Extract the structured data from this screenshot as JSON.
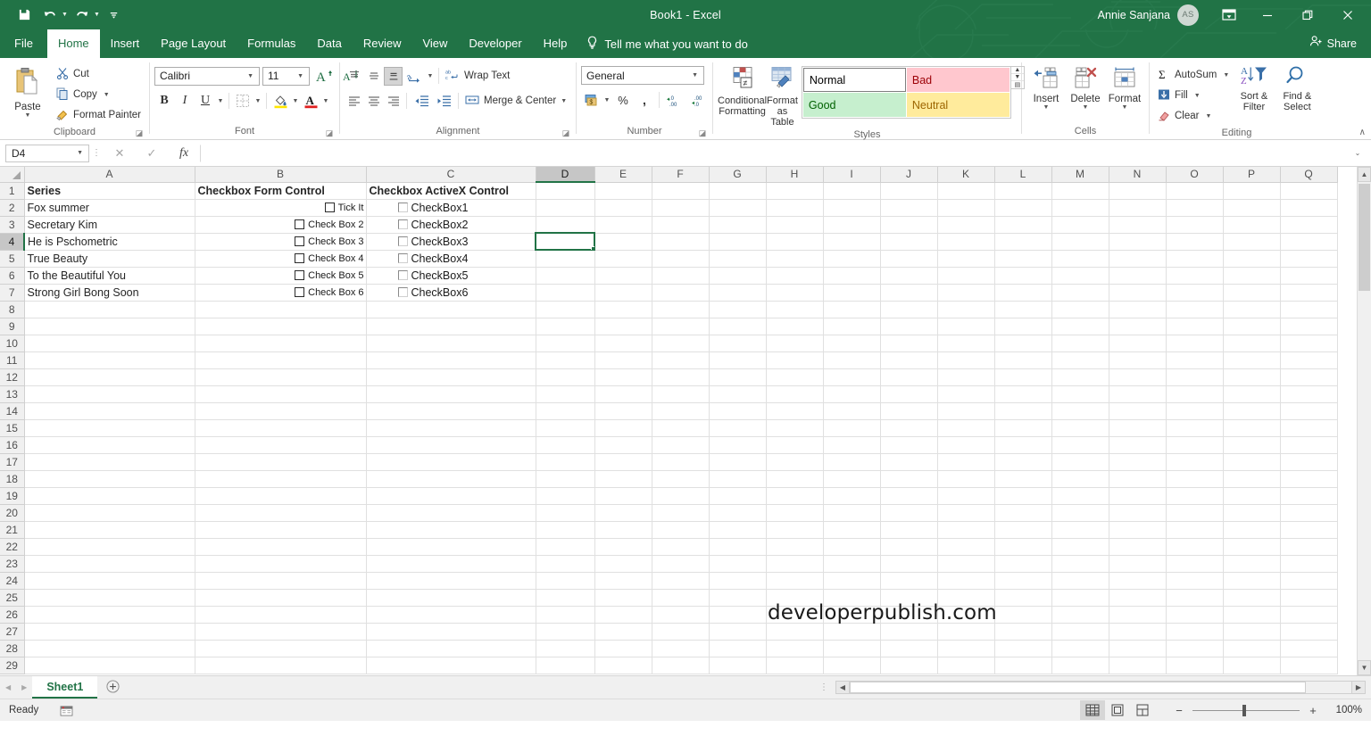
{
  "titlebar": {
    "document_title": "Book1  -  Excel",
    "account_name": "Annie Sanjana",
    "account_initials": "AS",
    "qat": [
      {
        "name": "save-icon",
        "label": "Save"
      },
      {
        "name": "undo-icon",
        "label": "Undo"
      },
      {
        "name": "redo-icon",
        "label": "Redo"
      },
      {
        "name": "customize-quick-access-toolbar-icon",
        "label": "Customize Quick Access Toolbar"
      }
    ],
    "ribbon_display_options": "Ribbon Display Options",
    "minimize": "—",
    "restore": "❐",
    "close": "✕"
  },
  "tabs": {
    "items": [
      {
        "label": "File",
        "active": false
      },
      {
        "label": "Home",
        "active": true
      },
      {
        "label": "Insert",
        "active": false
      },
      {
        "label": "Page Layout",
        "active": false
      },
      {
        "label": "Formulas",
        "active": false
      },
      {
        "label": "Data",
        "active": false
      },
      {
        "label": "Review",
        "active": false
      },
      {
        "label": "View",
        "active": false
      },
      {
        "label": "Developer",
        "active": false
      },
      {
        "label": "Help",
        "active": false
      }
    ],
    "tell_me": "Tell me what you want to do",
    "share": "Share"
  },
  "ribbon": {
    "clipboard": {
      "group_label": "Clipboard",
      "paste": "Paste",
      "cut": "Cut",
      "copy": "Copy",
      "format_painter": "Format Painter"
    },
    "font": {
      "group_label": "Font",
      "font_family": "Calibri",
      "font_size": "11",
      "grow_font": "A",
      "shrink_font": "A",
      "bold": "B",
      "italic": "I",
      "underline": "U",
      "borders": "Borders",
      "fill_color": "Fill Color",
      "font_color": "A"
    },
    "alignment": {
      "group_label": "Alignment",
      "top_align": "Top Align",
      "middle_align": "Middle Align",
      "bottom_align": "Bottom Align",
      "orientation": "Orientation",
      "align_left": "Align Left",
      "center": "Center",
      "align_right": "Align Right",
      "decrease_indent": "Decrease Indent",
      "increase_indent": "Increase Indent",
      "wrap_text": "Wrap Text",
      "merge_center": "Merge & Center"
    },
    "number": {
      "group_label": "Number",
      "format": "General",
      "accounting": "Accounting Number Format",
      "percent": "%",
      "comma": ",",
      "increase_decimal": "Increase Decimal",
      "decrease_decimal": "Decrease Decimal"
    },
    "styles": {
      "group_label": "Styles",
      "conditional_formatting": "Conditional Formatting",
      "format_as_table": "Format as Table",
      "cells": [
        {
          "label": "Normal",
          "kind": "normal"
        },
        {
          "label": "Bad",
          "kind": "bad"
        },
        {
          "label": "Good",
          "kind": "good"
        },
        {
          "label": "Neutral",
          "kind": "neutral"
        }
      ]
    },
    "cells_group": {
      "group_label": "Cells",
      "insert": "Insert",
      "delete": "Delete",
      "format": "Format"
    },
    "editing": {
      "group_label": "Editing",
      "autosum": "AutoSum",
      "fill": "Fill",
      "clear": "Clear",
      "sort_filter": "Sort &\nFilter",
      "sort_filter_l1": "Sort &",
      "sort_filter_l2": "Filter",
      "find_select_l1": "Find &",
      "find_select_l2": "Select"
    },
    "collapse_ribbon": "∧"
  },
  "formula_bar": {
    "name_box": "D4",
    "cancel": "✕",
    "enter": "✓",
    "insert_function": "fx",
    "formula_value": "",
    "expand": "⌄"
  },
  "grid": {
    "columns": [
      "A",
      "B",
      "C",
      "D",
      "E",
      "F",
      "G",
      "H",
      "I",
      "J",
      "K",
      "L",
      "M",
      "N",
      "O",
      "P",
      "Q"
    ],
    "selected_column": "D",
    "selected_row": 4,
    "selected_cell": "D4",
    "rows": [
      1,
      2,
      3,
      4,
      5,
      6,
      7,
      8,
      9,
      10,
      11,
      12,
      13,
      14,
      15,
      16,
      17,
      18,
      19,
      20,
      21,
      22,
      23,
      24,
      25,
      26,
      27,
      28,
      29
    ],
    "data": [
      {
        "row": 1,
        "A": "Series",
        "B_header": "Checkbox Form Control",
        "C_header": "Checkbox ActiveX Control"
      },
      {
        "row": 2,
        "A": "Fox summer",
        "B_checkbox": "Tick It",
        "C_checkbox": "CheckBox1"
      },
      {
        "row": 3,
        "A": "Secretary Kim",
        "B_checkbox": "Check Box 2",
        "C_checkbox": "CheckBox2"
      },
      {
        "row": 4,
        "A": "He is Pschometric",
        "B_checkbox": "Check Box 3",
        "C_checkbox": "CheckBox3"
      },
      {
        "row": 5,
        "A": "True Beauty",
        "B_checkbox": "Check Box 4",
        "C_checkbox": "CheckBox4"
      },
      {
        "row": 6,
        "A": "To the Beautiful You",
        "B_checkbox": "Check Box 5",
        "C_checkbox": "CheckBox5"
      },
      {
        "row": 7,
        "A": "Strong Girl Bong Soon",
        "B_checkbox": "Check Box 6",
        "C_checkbox": "CheckBox6"
      }
    ],
    "watermark": "developerpublish.com"
  },
  "sheet_tabs": {
    "sheets": [
      "Sheet1"
    ],
    "active_sheet": "Sheet1",
    "new_sheet": "+"
  },
  "status_bar": {
    "status": "Ready",
    "macro_record": "Record Macro",
    "views": [
      {
        "name": "normal-view",
        "label": "Normal"
      },
      {
        "name": "page-layout-view",
        "label": "Page Layout"
      },
      {
        "name": "page-break-preview",
        "label": "Page Break Preview"
      }
    ],
    "zoom_out": "−",
    "zoom_in": "+",
    "zoom_level": "100%"
  },
  "colors": {
    "brand_green": "#217346",
    "selection_green": "#217346",
    "bad_bg": "#ffc7ce",
    "bad_fg": "#9c0006",
    "good_bg": "#c6efce",
    "good_fg": "#006100",
    "neutral_bg": "#ffeb9c",
    "neutral_fg": "#9c6500"
  }
}
